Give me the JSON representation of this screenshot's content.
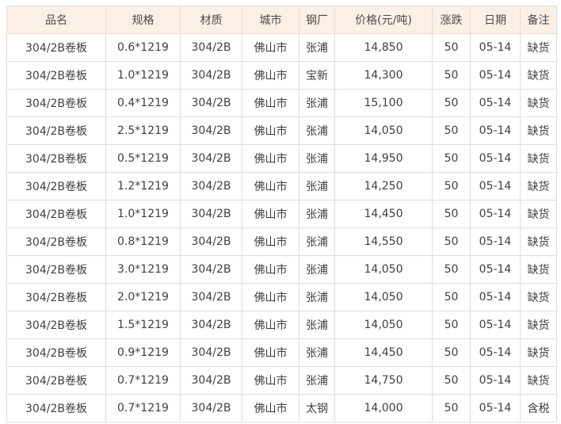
{
  "table": {
    "headers": [
      "品名",
      "规格",
      "材质",
      "城市",
      "钢厂",
      "价格(元/吨)",
      "涨跌",
      "日期",
      "备注"
    ],
    "rows": [
      [
        "304/2B卷板",
        "0.6*1219",
        "304/2B",
        "佛山市",
        "张浦",
        "14,850",
        "50",
        "05-14",
        "缺货"
      ],
      [
        "304/2B卷板",
        "1.0*1219",
        "304/2B",
        "佛山市",
        "宝新",
        "14,300",
        "50",
        "05-14",
        "缺货"
      ],
      [
        "304/2B卷板",
        "0.4*1219",
        "304/2B",
        "佛山市",
        "张浦",
        "15,100",
        "50",
        "05-14",
        "缺货"
      ],
      [
        "304/2B卷板",
        "2.5*1219",
        "304/2B",
        "佛山市",
        "张浦",
        "14,050",
        "50",
        "05-14",
        "缺货"
      ],
      [
        "304/2B卷板",
        "0.5*1219",
        "304/2B",
        "佛山市",
        "张浦",
        "14,950",
        "50",
        "05-14",
        "缺货"
      ],
      [
        "304/2B卷板",
        "1.2*1219",
        "304/2B",
        "佛山市",
        "张浦",
        "14,250",
        "50",
        "05-14",
        "缺货"
      ],
      [
        "304/2B卷板",
        "1.0*1219",
        "304/2B",
        "佛山市",
        "张浦",
        "14,450",
        "50",
        "05-14",
        "缺货"
      ],
      [
        "304/2B卷板",
        "0.8*1219",
        "304/2B",
        "佛山市",
        "张浦",
        "14,550",
        "50",
        "05-14",
        "缺货"
      ],
      [
        "304/2B卷板",
        "3.0*1219",
        "304/2B",
        "佛山市",
        "张浦",
        "14,050",
        "50",
        "05-14",
        "缺货"
      ],
      [
        "304/2B卷板",
        "2.0*1219",
        "304/2B",
        "佛山市",
        "张浦",
        "14,050",
        "50",
        "05-14",
        "缺货"
      ],
      [
        "304/2B卷板",
        "1.5*1219",
        "304/2B",
        "佛山市",
        "张浦",
        "14,050",
        "50",
        "05-14",
        "缺货"
      ],
      [
        "304/2B卷板",
        "0.9*1219",
        "304/2B",
        "佛山市",
        "张浦",
        "14,450",
        "50",
        "05-14",
        "缺货"
      ],
      [
        "304/2B卷板",
        "0.7*1219",
        "304/2B",
        "佛山市",
        "张浦",
        "14,750",
        "50",
        "05-14",
        "缺货"
      ],
      [
        "304/2B卷板",
        "0.7*1219",
        "304/2B",
        "佛山市",
        "太钢",
        "14,000",
        "50",
        "05-14",
        "含税"
      ]
    ]
  },
  "colors": {
    "header_bg": "#fbf0e8",
    "border": "#e3dcd6",
    "text": "#404040"
  }
}
